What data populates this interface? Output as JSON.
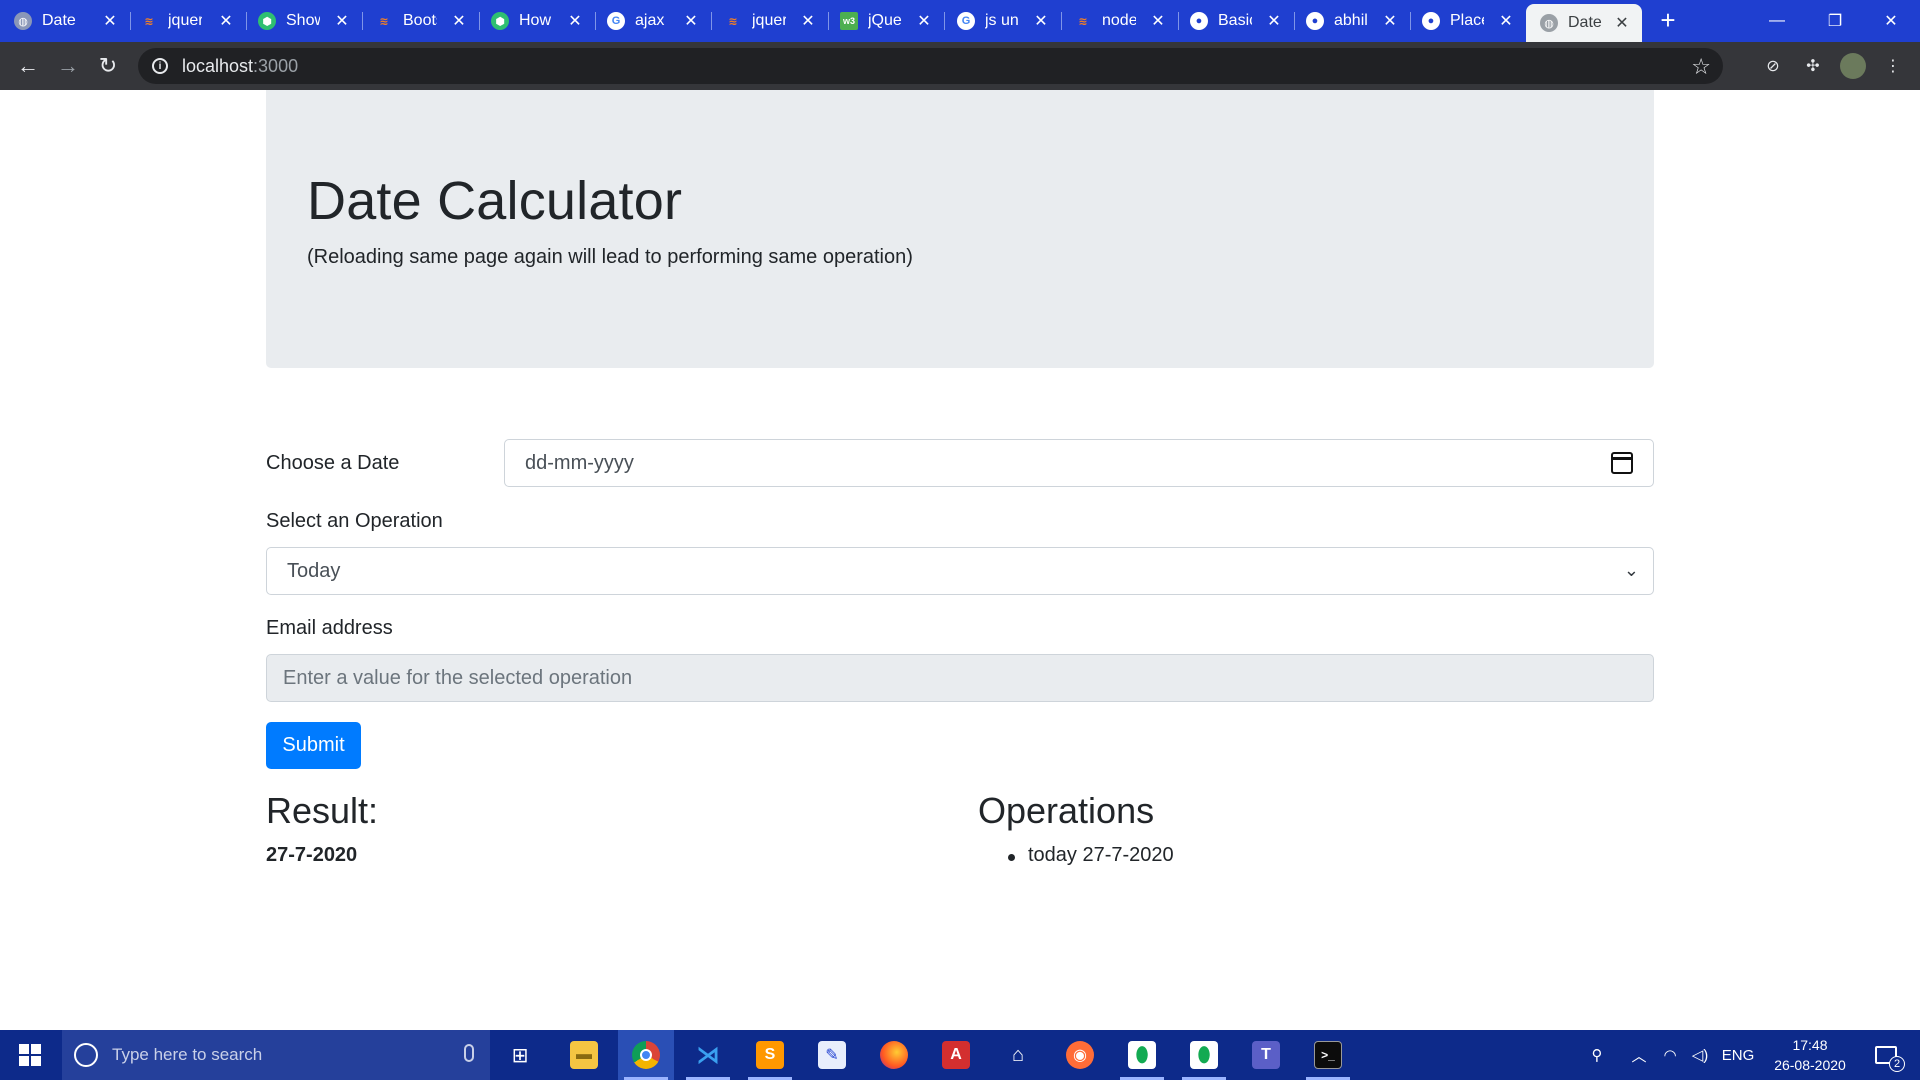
{
  "browser": {
    "tabs": [
      {
        "label": "Date",
        "icon": "globe-icon"
      },
      {
        "label": "jquery",
        "icon": "stackoverflow-icon"
      },
      {
        "label": "Show",
        "icon": "hexagon-icon"
      },
      {
        "label": "Boots",
        "icon": "stackoverflow-icon"
      },
      {
        "label": "How",
        "icon": "hexagon-icon"
      },
      {
        "label": "ajax -",
        "icon": "google-icon"
      },
      {
        "label": "jquery",
        "icon": "stackoverflow-icon"
      },
      {
        "label": "jQuer",
        "icon": "w3schools-icon"
      },
      {
        "label": "js uns",
        "icon": "google-icon"
      },
      {
        "label": "node",
        "icon": "stackoverflow-icon"
      },
      {
        "label": "Basic",
        "icon": "github-icon"
      },
      {
        "label": "abhil",
        "icon": "github-icon"
      },
      {
        "label": "Place",
        "icon": "github-icon"
      },
      {
        "label": "Date",
        "icon": "globe-icon",
        "active": true
      }
    ],
    "url_host": "localhost",
    "url_port": ":3000"
  },
  "page": {
    "title": "Date Calculator",
    "subtitle": "(Reloading same page again will lead to performing same operation)",
    "date_label": "Choose a Date",
    "date_placeholder": "dd-mm-yyyy",
    "operation_label": "Select an Operation",
    "operation_selected": "Today",
    "value_label": "Email address",
    "value_placeholder": "Enter a value for the selected operation",
    "submit_label": "Submit",
    "result_heading": "Result:",
    "result_value": "27-7-2020",
    "operations_heading": "Operations",
    "operations": [
      "today 27-7-2020"
    ]
  },
  "taskbar": {
    "search_placeholder": "Type here to search",
    "language": "ENG",
    "time": "17:48",
    "date": "26-08-2020",
    "notification_count": "2"
  },
  "colors": {
    "tabstrip": "#1f3fd0",
    "jumbotron": "#e9ecef",
    "primary": "#007bff",
    "taskbar": "#0d2a8a"
  }
}
